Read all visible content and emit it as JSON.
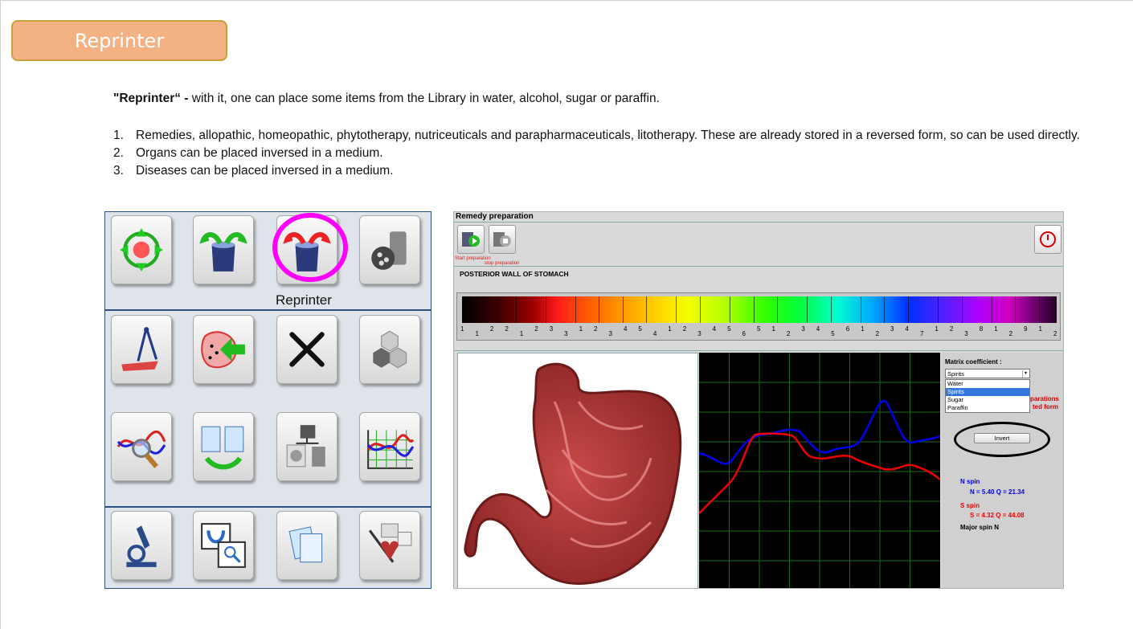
{
  "slide": {
    "title": "Reprinter",
    "intro_bold": "\"Reprinter“  -",
    "intro_text": " with it, one can place some items from the Library in water, alcohol, sugar or paraffin.",
    "list": [
      {
        "num": "1.",
        "text": "Remedies, allopathic, homeopathic, phytotherapy, nutriceuticals and parapharmaceuticals, litotherapy. These are already stored in a reversed form, so can be used directly."
      },
      {
        "num": "2.",
        "text": "Organs can be placed inversed in a medium."
      },
      {
        "num": "3.",
        "text": "Diseases can be placed inversed in a medium."
      }
    ]
  },
  "icon_panel": {
    "highlight_label": "Reprinter",
    "icons": [
      "target-arrows-icon",
      "cup-green-arrows-icon",
      "reprinter-icon",
      "grinder-icon",
      "ruler-compass-icon",
      "organ-insert-icon",
      "close-icon",
      "hexagons-icon",
      "wave-magnifier-icon",
      "clipboard-cycle-icon",
      "device-bin-icon",
      "spectrum-graph-icon",
      "microscope-icon",
      "window-search-icon",
      "clipboard-icon",
      "heart-windows-icon"
    ],
    "highlight_color": "#ff00ff"
  },
  "app": {
    "window_title": "Remedy preparation",
    "start_label": "Start preparation",
    "stop_label": "stop preparation",
    "organ_name": "POSTERIOR WALL OF STOMACH",
    "scale_labels": [
      "1",
      "1",
      "2",
      "2",
      "1",
      "2",
      "3",
      "3",
      "1",
      "2",
      "3",
      "4",
      "5",
      "4",
      "1",
      "2",
      "3",
      "4",
      "5",
      "6",
      "5",
      "1",
      "2",
      "3",
      "4",
      "5",
      "6",
      "1",
      "2",
      "3",
      "4",
      "7",
      "1",
      "2",
      "3",
      "8",
      "1",
      "2",
      "9",
      "1",
      "2"
    ],
    "matrix_label": "Matrix coefficient :",
    "matrix_selected": "Spirits",
    "matrix_options": [
      "Water",
      "Spirits",
      "Sugar",
      "Paraffin"
    ],
    "preparations_partial": "parations",
    "inverted_partial": "ted form",
    "invert_button": "Invert",
    "n_spin_label": "N spin",
    "n_spin_values": "N = 5.40  Q = 21.34",
    "s_spin_label": "S spin",
    "s_spin_values": "S = 4.32  Q = 44.08",
    "major_spin": "Major spin N",
    "colors": {
      "n_spin": "#0000ee",
      "s_spin": "#ee0000",
      "grid": "#1a6b1a"
    }
  }
}
